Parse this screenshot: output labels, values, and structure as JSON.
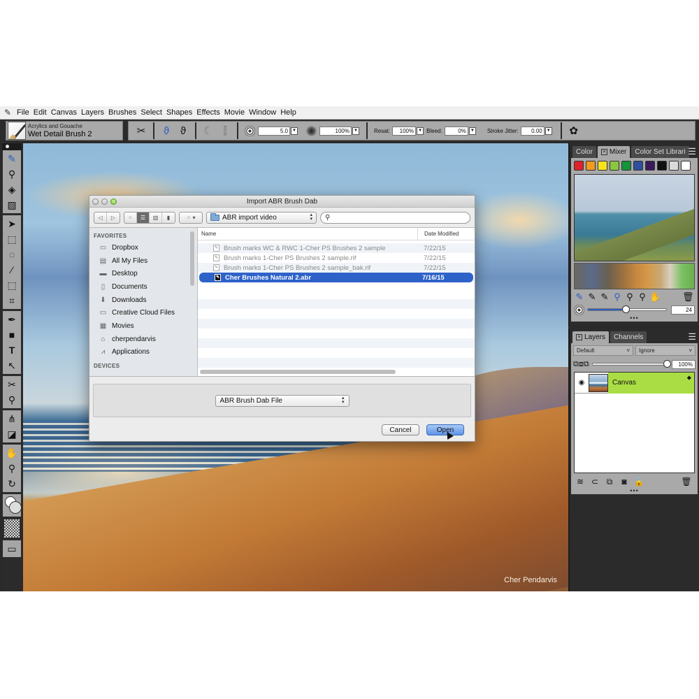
{
  "menubar": {
    "items": [
      "File",
      "Edit",
      "Canvas",
      "Layers",
      "Brushes",
      "Select",
      "Shapes",
      "Effects",
      "Movie",
      "Window",
      "Help"
    ]
  },
  "property_bar": {
    "brush_category": "Acrylics and Gouache",
    "brush_variant": "Wet Detail Brush 2",
    "size_value": "5.0",
    "opacity_value": "100%",
    "resat_label": "Resat:",
    "resat_value": "100%",
    "bleed_label": "Bleed:",
    "bleed_value": "0%",
    "stroke_jitter_label": "Stroke Jitter:",
    "stroke_jitter_value": "0.00"
  },
  "toolbox": {
    "tools": [
      "brush-tool",
      "dropper-tool",
      "paint-bucket-tool",
      "eraser-tool",
      "layer-adjuster-tool",
      "rectangular-selection-tool",
      "lasso-tool",
      "magic-wand-tool",
      "selection-adjuster-tool",
      "crop-tool",
      "pen-tool",
      "rectangle-shape-tool",
      "text-tool",
      "shape-selection-tool",
      "cloner-tool",
      "rubber-stamp-tool",
      "mirror-tool",
      "divine-proportion-tool",
      "grabber-tool",
      "magnifier-tool",
      "rotate-page-tool"
    ]
  },
  "canvas": {
    "signature": "Cher Pendarvis"
  },
  "mixer_panel": {
    "tabs": [
      "Color",
      "Mixer",
      "Color Set Librari"
    ],
    "active_tab": "Mixer",
    "swatches": [
      "#e0202a",
      "#f39a1c",
      "#f7e21c",
      "#8cc63e",
      "#14953a",
      "#2d4f9c",
      "#3a1a5c",
      "#111111",
      "#d9d9d9",
      "#ffffff"
    ],
    "brush_size_value": "24",
    "brush_size_fraction": 0.48
  },
  "layers_panel": {
    "tabs": [
      "Layers",
      "Channels"
    ],
    "active_tab": "Layers",
    "composite_method": "Default",
    "composite_depth": "Ignore",
    "opacity_value": "100%",
    "opacity_fraction": 1.0,
    "layers": [
      {
        "name": "Canvas",
        "selected": true
      }
    ]
  },
  "dialog": {
    "title": "Import ABR Brush Dab",
    "current_folder": "ABR import video",
    "search_placeholder": "",
    "sidebar": {
      "favorites_heading": "FAVORITES",
      "favorites": [
        {
          "label": "Dropbox",
          "icon": "folder-icon"
        },
        {
          "label": "All My Files",
          "icon": "all-files-icon"
        },
        {
          "label": "Desktop",
          "icon": "desktop-icon"
        },
        {
          "label": "Documents",
          "icon": "documents-icon"
        },
        {
          "label": "Downloads",
          "icon": "downloads-icon"
        },
        {
          "label": "Creative Cloud Files",
          "icon": "folder-icon"
        },
        {
          "label": "Movies",
          "icon": "movies-icon"
        },
        {
          "label": "cherpendarvis",
          "icon": "home-icon"
        },
        {
          "label": "Applications",
          "icon": "applications-icon"
        }
      ],
      "devices_heading": "DEVICES"
    },
    "columns": {
      "name": "Name",
      "date": "Date Modified"
    },
    "files": [
      {
        "name": "Brush marks WC & RWC 1-Cher PS Brushes 2 sample",
        "date": "7/22/15",
        "selected": false
      },
      {
        "name": "Brush marks 1-Cher PS Brushes 2 sample.rif",
        "date": "7/22/15",
        "selected": false
      },
      {
        "name": "Brush marks 1-Cher PS Brushes 2 sample_bak.rif",
        "date": "7/22/15",
        "selected": false
      },
      {
        "name": "Cher Brushes Natural 2.abr",
        "date": "7/16/15",
        "selected": true
      }
    ],
    "file_format": "ABR Brush Dab File",
    "cancel_label": "Cancel",
    "open_label": "Open"
  }
}
